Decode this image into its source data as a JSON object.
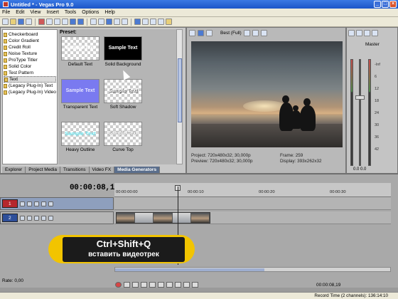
{
  "window": {
    "title": "Untitled * - Vegas Pro 9.0"
  },
  "menu": [
    "File",
    "Edit",
    "View",
    "Insert",
    "Tools",
    "Options",
    "Help"
  ],
  "explorer": {
    "tree": [
      {
        "label": "Checkerboard",
        "selected": false
      },
      {
        "label": "Color Gradient",
        "selected": false
      },
      {
        "label": "Credit Roll",
        "selected": false
      },
      {
        "label": "Noise Texture",
        "selected": false
      },
      {
        "label": "ProType Titler",
        "selected": false
      },
      {
        "label": "Solid Color",
        "selected": false
      },
      {
        "label": "Test Pattern",
        "selected": false
      },
      {
        "label": "Text",
        "selected": true
      },
      {
        "label": "(Legacy Plug-In) Text",
        "selected": false
      },
      {
        "label": "(Legacy Plug-In) Video",
        "selected": false
      }
    ],
    "preset_heading": "Preset:",
    "presets": [
      {
        "label": "Default Text",
        "thumb_text": "Sample Text",
        "style": "default"
      },
      {
        "label": "Solid Background",
        "thumb_text": "Sample Text",
        "style": "black"
      },
      {
        "label": "Transparent Text",
        "thumb_text": "Sample Text",
        "style": "blue"
      },
      {
        "label": "Soft Shadow",
        "thumb_text": "Sample Text",
        "style": "shadow"
      },
      {
        "label": "Heavy Outline",
        "thumb_text": "Sample Text",
        "style": "outline"
      },
      {
        "label": "Curve Top",
        "thumb_text": "Sample Text",
        "style": "curve"
      }
    ],
    "tabs": [
      {
        "label": "Explorer",
        "active": false
      },
      {
        "label": "Project Media",
        "active": false
      },
      {
        "label": "Transitions",
        "active": false
      },
      {
        "label": "Video FX",
        "active": false
      },
      {
        "label": "Media Generators",
        "active": true
      }
    ]
  },
  "preview": {
    "quality": "Best (Full)",
    "project_label": "Project:",
    "project_value": "720x480x32; 30,000p",
    "preview_label": "Preview:",
    "preview_value": "720x480x32; 30,000p",
    "frame_label": "Frame:",
    "frame_value": "259",
    "display_label": "Display:",
    "display_value": "393x262x32"
  },
  "mixer": {
    "master_label": "Master",
    "scale": [
      "-Inf",
      "6",
      "12",
      "18",
      "24",
      "30",
      "36",
      "42",
      "48",
      "54"
    ],
    "bottom_values": "0.0   0.0"
  },
  "timeline": {
    "timecode": "00:00:08,19",
    "ruler": [
      "00:00:00:00",
      "00:00:10",
      "00:00:20",
      "00:00:30",
      "00:00:40"
    ],
    "tracks": [
      {
        "number": "1",
        "color": "#b5272d"
      },
      {
        "number": "2",
        "color": "#2e4f9a"
      }
    ],
    "rate": "Rate: 0,00",
    "timecode_small": "00:00:08,19",
    "overlay_line1": "Ctrl+Shift+Q",
    "overlay_line2": "вставить видеотрек"
  },
  "status": {
    "record_time": "Record Time (2 channels): 136:14:10"
  }
}
